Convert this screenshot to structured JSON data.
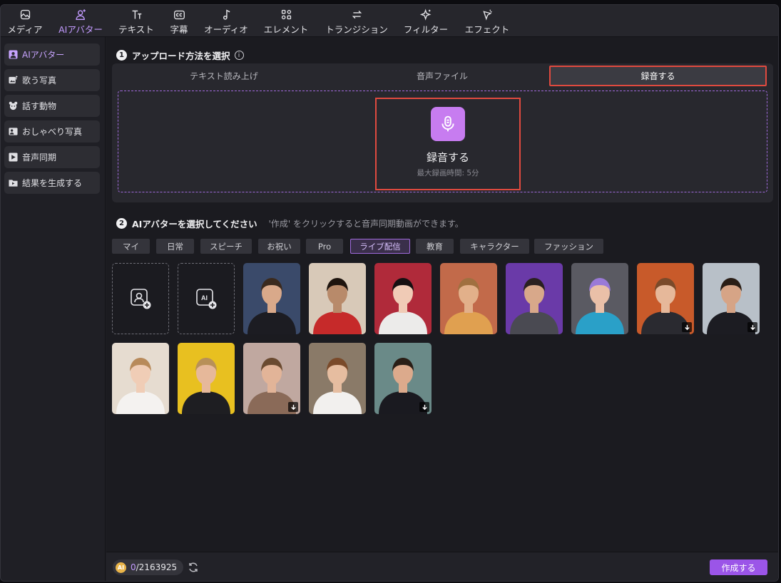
{
  "toolbar": {
    "items": [
      {
        "label": "メディア",
        "icon": "media-icon"
      },
      {
        "label": "AIアバター",
        "icon": "ai-avatar-icon"
      },
      {
        "label": "テキスト",
        "icon": "text-icon"
      },
      {
        "label": "字幕",
        "icon": "subtitle-cc-icon"
      },
      {
        "label": "オーディオ",
        "icon": "audio-note-icon"
      },
      {
        "label": "エレメント",
        "icon": "element-icon"
      },
      {
        "label": "トランジション",
        "icon": "transition-arrows-icon"
      },
      {
        "label": "フィルター",
        "icon": "filter-sparkle-icon"
      },
      {
        "label": "エフェクト",
        "icon": "effect-icon"
      }
    ],
    "active_index": 1
  },
  "sidebar": {
    "items": [
      {
        "label": "AIアバター",
        "icon": "avatar-icon"
      },
      {
        "label": "歌う写真",
        "icon": "singing-photo-icon"
      },
      {
        "label": "話す動物",
        "icon": "talking-animal-icon"
      },
      {
        "label": "おしゃべり写真",
        "icon": "talking-photo-icon"
      },
      {
        "label": "音声同期",
        "icon": "lip-sync-icon"
      },
      {
        "label": "結果を生成する",
        "icon": "folder-icon"
      }
    ],
    "active_index": 0
  },
  "step1": {
    "number": "1",
    "title": "アップロード方法を選択",
    "info": "i",
    "tabs": [
      "テキスト読み上げ",
      "音声ファイル",
      "録音する"
    ],
    "selected_tab": 2,
    "record": {
      "title": "録音する",
      "subtitle": "最大録画時間: 5分",
      "icon": "microphone-icon"
    }
  },
  "step2": {
    "number": "2",
    "title": "AIアバターを選択してください",
    "hint": "'作成' をクリックすると音声同期動画ができます。",
    "categories": [
      "マイ",
      "日常",
      "スピーチ",
      "お祝い",
      "Pro",
      "ライブ配信",
      "教育",
      "キャラクター",
      "ファッション"
    ],
    "selected_category": 5
  },
  "avatars": [
    {
      "type": "add-photo",
      "icon": "add-photo-avatar-icon"
    },
    {
      "type": "add-ai",
      "icon": "add-ai-avatar-icon"
    },
    {
      "type": "avatar",
      "bg": "#3a4a6a",
      "shirt": "#1c1c22",
      "hair": "#3a2a1e",
      "skin": "#d9a98a",
      "download": false
    },
    {
      "type": "avatar",
      "bg": "#d8c9b8",
      "shirt": "#c62a2a",
      "hair": "#1e140e",
      "skin": "#b88a6a",
      "download": false
    },
    {
      "type": "avatar",
      "bg": "#b02a3a",
      "shirt": "#ecebea",
      "hair": "#161012",
      "skin": "#f0cbb6",
      "download": false
    },
    {
      "type": "avatar",
      "bg": "#c26a4a",
      "shirt": "#e0a050",
      "hair": "#a07040",
      "skin": "#e2b08a",
      "download": false
    },
    {
      "type": "avatar",
      "bg": "#6a3aa8",
      "shirt": "#4a4a52",
      "hair": "#2a2020",
      "skin": "#d8a88a",
      "download": false
    },
    {
      "type": "avatar",
      "bg": "#5a5a62",
      "shirt": "#2aa0c8",
      "hair": "#9a7ad8",
      "skin": "#eac0a8",
      "download": false
    },
    {
      "type": "avatar",
      "bg": "#c85a2a",
      "shirt": "#2a2a30",
      "hair": "#7a4a2a",
      "skin": "#e6b89a",
      "download": true
    },
    {
      "type": "avatar",
      "bg": "#b8c0c8",
      "shirt": "#1c1c22",
      "hair": "#2a1e16",
      "skin": "#d6a486",
      "download": true
    },
    {
      "type": "avatar",
      "bg": "#e6dcd0",
      "shirt": "#f4f2f0",
      "hair": "#b88a5a",
      "skin": "#f0cdb6",
      "download": false
    },
    {
      "type": "avatar",
      "bg": "#e8c020",
      "shirt": "#1e1e22",
      "hair": "#b89058",
      "skin": "#e6b89a",
      "download": false
    },
    {
      "type": "avatar",
      "bg": "#c0a8a0",
      "shirt": "#8a6a58",
      "hair": "#6a4a30",
      "skin": "#e2b498",
      "download": true
    },
    {
      "type": "avatar",
      "bg": "#8a7a68",
      "shirt": "#f2f0ee",
      "hair": "#7a4a2a",
      "skin": "#e6bda0",
      "download": false
    },
    {
      "type": "avatar",
      "bg": "#6a8a88",
      "shirt": "#1a1a20",
      "hair": "#2a1e16",
      "skin": "#dcaa8c",
      "download": true
    }
  ],
  "footer": {
    "coin_label": "AI",
    "credits_used": "0",
    "credits_total": "/2163925",
    "create_label": "作成する"
  },
  "colors": {
    "accent": "#9b55e8",
    "highlight": "#e04a3f",
    "mic": "#c77cf0"
  }
}
